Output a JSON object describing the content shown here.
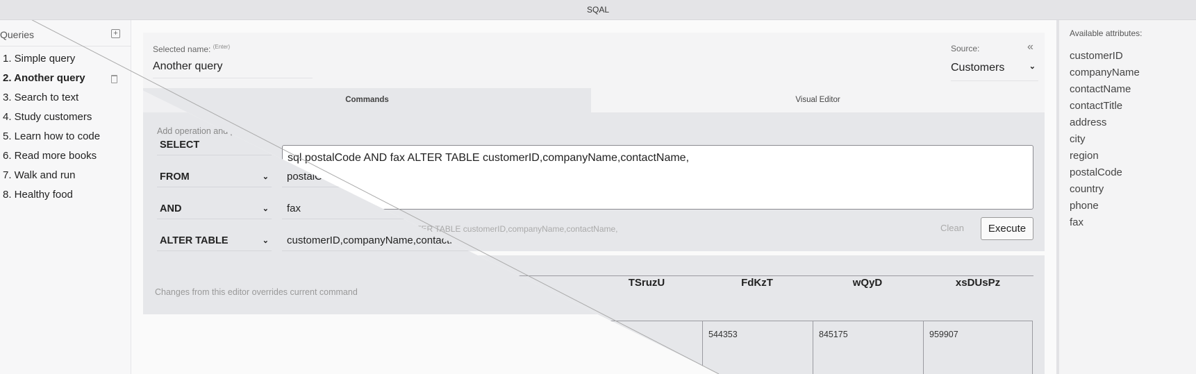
{
  "app": {
    "title": "SQAL"
  },
  "sidebar": {
    "header": "Queries",
    "add_icon": "plus-square-icon",
    "delete_icon": "trash-icon",
    "items": [
      {
        "label": "1. Simple query"
      },
      {
        "label": "2. Another query",
        "selected": true
      },
      {
        "label": "3. Search to text"
      },
      {
        "label": "4. Study customers"
      },
      {
        "label": "5. Learn how to code"
      },
      {
        "label": "6. Read more books"
      },
      {
        "label": "7. Walk and run"
      },
      {
        "label": "8. Healthy food"
      }
    ]
  },
  "header": {
    "name_label": "Selected name:",
    "name_hint": "(Enter)",
    "name_value": "Another query",
    "source_label": "Source:",
    "source_value": "Customers",
    "collapse_icon": "double-chevron-left-icon"
  },
  "tabs": [
    {
      "label": "Commands",
      "active": true
    },
    {
      "label": "Visual Editor"
    }
  ],
  "visual_editor": {
    "hint": "Add operation and parameters",
    "footer": "Changes from this editor overrides current command",
    "rows": [
      {
        "op": "SELECT",
        "value": "sql"
      },
      {
        "op": "FROM",
        "value": "postalCode"
      },
      {
        "op": "AND",
        "value": "fax"
      },
      {
        "op": "ALTER TABLE",
        "value": "customerID,companyName,contactName,"
      }
    ]
  },
  "commands": {
    "text": "sql postalCode AND fax ALTER TABLE customerID,companyName,contactName,",
    "preview": "sql postalCode AND fax ALTER TABLE customerID,companyName,contactName,",
    "clean_label": "Clean",
    "execute_label": "Execute"
  },
  "results": {
    "columns": [
      "TSruzU",
      "FdKzT",
      "wQyD",
      "xsDUsPz"
    ],
    "rows": [
      [
        "",
        "544353",
        "845175",
        "959907"
      ]
    ]
  },
  "attributes": {
    "title": "Available attributes:",
    "items": [
      "customerID",
      "companyName",
      "contactName",
      "contactTitle",
      "address",
      "city",
      "region",
      "postalCode",
      "country",
      "phone",
      "fax"
    ]
  }
}
